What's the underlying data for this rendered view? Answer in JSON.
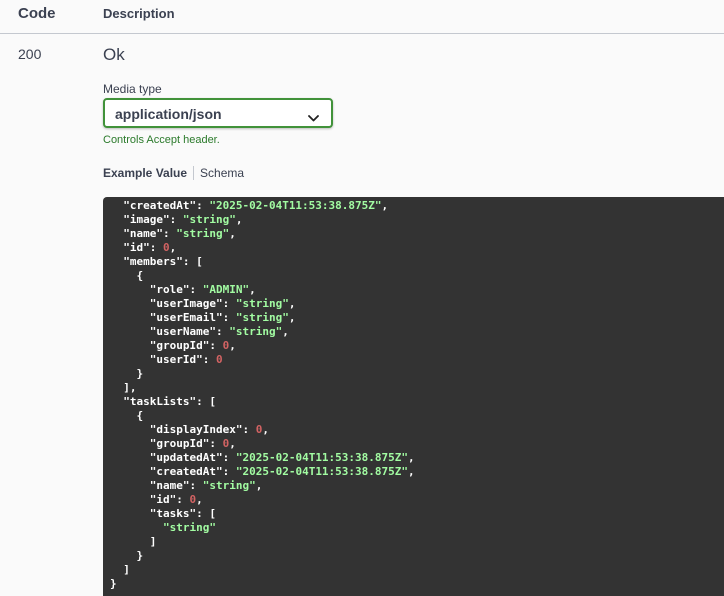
{
  "table_header": {
    "code": "Code",
    "description": "Description"
  },
  "response": {
    "code": "200",
    "description": "Ok",
    "media_type_label": "Media type",
    "media_type_value": "application/json",
    "accept_note": "Controls Accept header."
  },
  "tabs": {
    "example": "Example Value",
    "schema": "Schema"
  },
  "colors": {
    "select_border": "#41923a",
    "code_bg": "#333333",
    "string": "#a2fca2",
    "number": "#d36363"
  },
  "icons": {
    "select_arrow": "chevron-down-icon"
  },
  "json_lines": [
    {
      "indent": 1,
      "parts": [
        {
          "t": "p",
          "v": "\"createdAt\": "
        },
        {
          "t": "s",
          "v": "\"2025-02-04T11:53:38.875Z\""
        },
        {
          "t": "p",
          "v": ","
        }
      ]
    },
    {
      "indent": 1,
      "parts": [
        {
          "t": "p",
          "v": "\"image\": "
        },
        {
          "t": "s",
          "v": "\"string\""
        },
        {
          "t": "p",
          "v": ","
        }
      ]
    },
    {
      "indent": 1,
      "parts": [
        {
          "t": "p",
          "v": "\"name\": "
        },
        {
          "t": "s",
          "v": "\"string\""
        },
        {
          "t": "p",
          "v": ","
        }
      ]
    },
    {
      "indent": 1,
      "parts": [
        {
          "t": "p",
          "v": "\"id\": "
        },
        {
          "t": "n",
          "v": "0"
        },
        {
          "t": "p",
          "v": ","
        }
      ]
    },
    {
      "indent": 1,
      "parts": [
        {
          "t": "p",
          "v": "\"members\": ["
        }
      ]
    },
    {
      "indent": 2,
      "parts": [
        {
          "t": "p",
          "v": "{"
        }
      ]
    },
    {
      "indent": 3,
      "parts": [
        {
          "t": "p",
          "v": "\"role\": "
        },
        {
          "t": "s",
          "v": "\"ADMIN\""
        },
        {
          "t": "p",
          "v": ","
        }
      ]
    },
    {
      "indent": 3,
      "parts": [
        {
          "t": "p",
          "v": "\"userImage\": "
        },
        {
          "t": "s",
          "v": "\"string\""
        },
        {
          "t": "p",
          "v": ","
        }
      ]
    },
    {
      "indent": 3,
      "parts": [
        {
          "t": "p",
          "v": "\"userEmail\": "
        },
        {
          "t": "s",
          "v": "\"string\""
        },
        {
          "t": "p",
          "v": ","
        }
      ]
    },
    {
      "indent": 3,
      "parts": [
        {
          "t": "p",
          "v": "\"userName\": "
        },
        {
          "t": "s",
          "v": "\"string\""
        },
        {
          "t": "p",
          "v": ","
        }
      ]
    },
    {
      "indent": 3,
      "parts": [
        {
          "t": "p",
          "v": "\"groupId\": "
        },
        {
          "t": "n",
          "v": "0"
        },
        {
          "t": "p",
          "v": ","
        }
      ]
    },
    {
      "indent": 3,
      "parts": [
        {
          "t": "p",
          "v": "\"userId\": "
        },
        {
          "t": "n",
          "v": "0"
        }
      ]
    },
    {
      "indent": 2,
      "parts": [
        {
          "t": "p",
          "v": "}"
        }
      ]
    },
    {
      "indent": 1,
      "parts": [
        {
          "t": "p",
          "v": "],"
        }
      ]
    },
    {
      "indent": 1,
      "parts": [
        {
          "t": "p",
          "v": "\"taskLists\": ["
        }
      ]
    },
    {
      "indent": 2,
      "parts": [
        {
          "t": "p",
          "v": "{"
        }
      ]
    },
    {
      "indent": 3,
      "parts": [
        {
          "t": "p",
          "v": "\"displayIndex\": "
        },
        {
          "t": "n",
          "v": "0"
        },
        {
          "t": "p",
          "v": ","
        }
      ]
    },
    {
      "indent": 3,
      "parts": [
        {
          "t": "p",
          "v": "\"groupId\": "
        },
        {
          "t": "n",
          "v": "0"
        },
        {
          "t": "p",
          "v": ","
        }
      ]
    },
    {
      "indent": 3,
      "parts": [
        {
          "t": "p",
          "v": "\"updatedAt\": "
        },
        {
          "t": "s",
          "v": "\"2025-02-04T11:53:38.875Z\""
        },
        {
          "t": "p",
          "v": ","
        }
      ]
    },
    {
      "indent": 3,
      "parts": [
        {
          "t": "p",
          "v": "\"createdAt\": "
        },
        {
          "t": "s",
          "v": "\"2025-02-04T11:53:38.875Z\""
        },
        {
          "t": "p",
          "v": ","
        }
      ]
    },
    {
      "indent": 3,
      "parts": [
        {
          "t": "p",
          "v": "\"name\": "
        },
        {
          "t": "s",
          "v": "\"string\""
        },
        {
          "t": "p",
          "v": ","
        }
      ]
    },
    {
      "indent": 3,
      "parts": [
        {
          "t": "p",
          "v": "\"id\": "
        },
        {
          "t": "n",
          "v": "0"
        },
        {
          "t": "p",
          "v": ","
        }
      ]
    },
    {
      "indent": 3,
      "parts": [
        {
          "t": "p",
          "v": "\"tasks\": ["
        }
      ]
    },
    {
      "indent": 4,
      "parts": [
        {
          "t": "s",
          "v": "\"string\""
        }
      ]
    },
    {
      "indent": 3,
      "parts": [
        {
          "t": "p",
          "v": "]"
        }
      ]
    },
    {
      "indent": 2,
      "parts": [
        {
          "t": "p",
          "v": "}"
        }
      ]
    },
    {
      "indent": 1,
      "parts": [
        {
          "t": "p",
          "v": "]"
        }
      ]
    },
    {
      "indent": 0,
      "parts": [
        {
          "t": "p",
          "v": "}"
        }
      ]
    }
  ]
}
